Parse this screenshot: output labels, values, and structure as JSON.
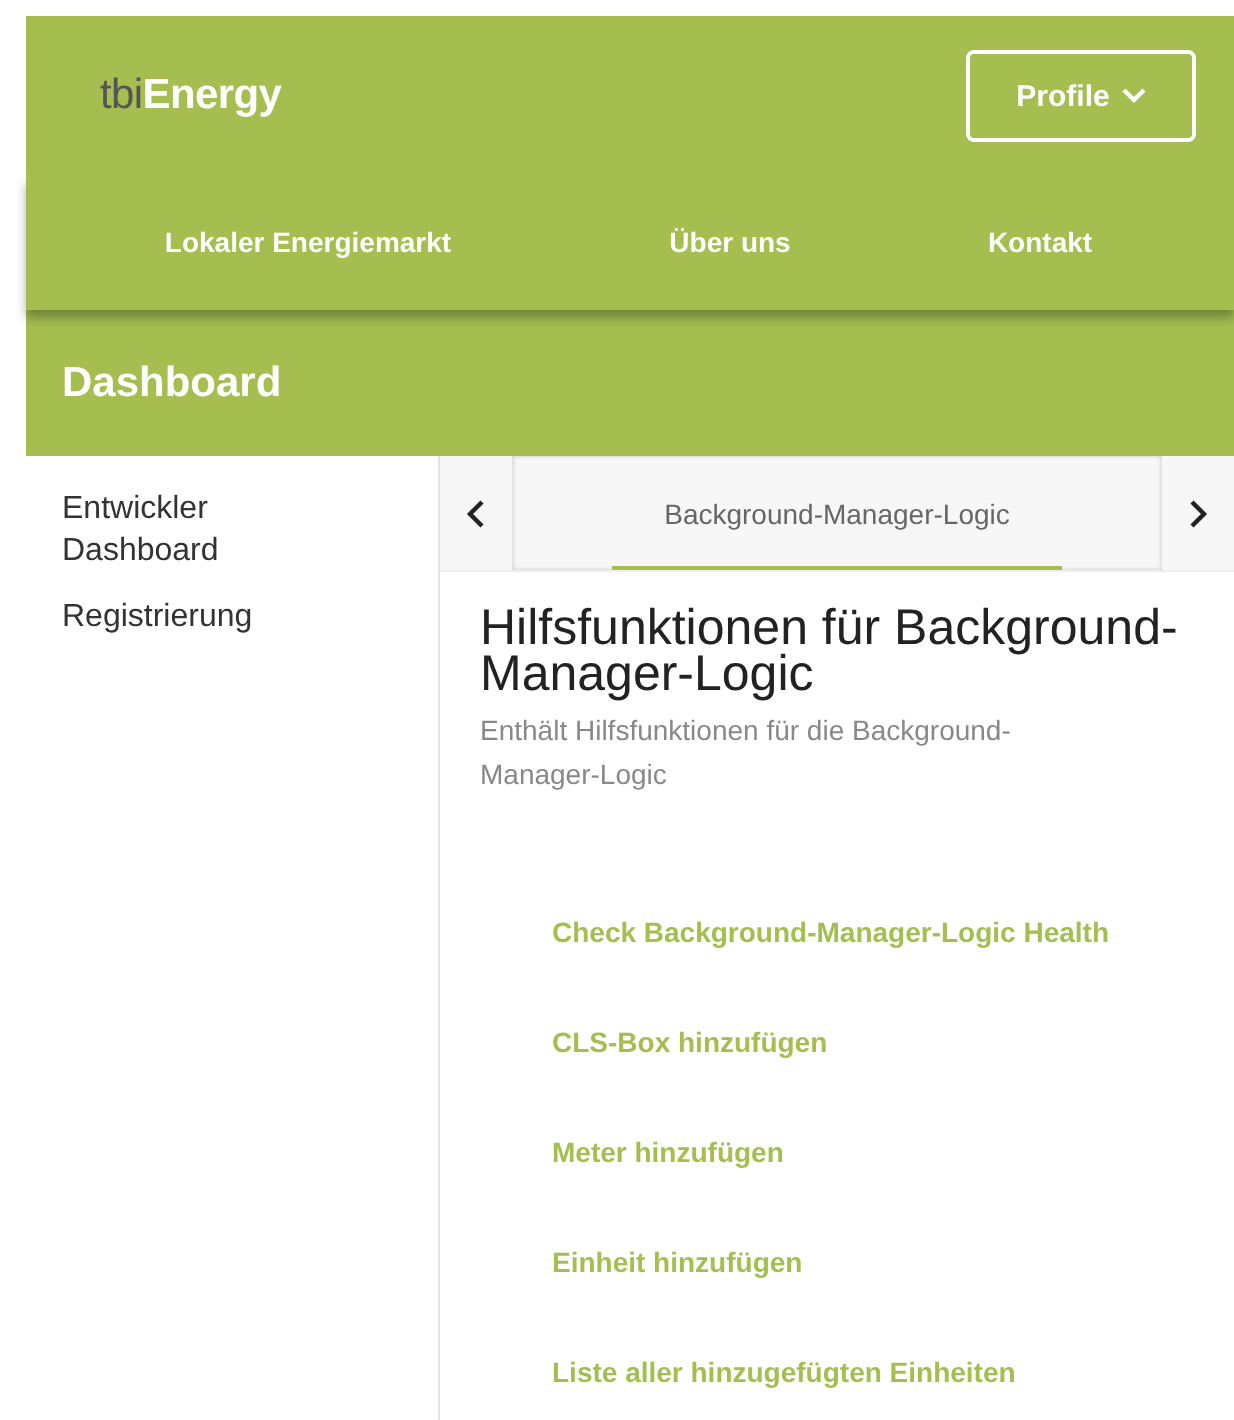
{
  "header": {
    "logo": {
      "prefix": "tbi",
      "name": "Energy"
    },
    "profile_button": {
      "label": "Profile"
    }
  },
  "nav": [
    {
      "label": "Lokaler Energiemarkt"
    },
    {
      "label": "Über uns"
    },
    {
      "label": "Kontakt"
    }
  ],
  "page_title": "Dashboard",
  "sidebar": {
    "items": [
      {
        "label": "Entwickler Dashboard"
      },
      {
        "label": "Registrierung"
      }
    ]
  },
  "tabs": [
    {
      "label": "Background-Manager-Logic",
      "selected": true
    }
  ],
  "content": {
    "title": "Hilfsfunktionen für Background-Manager-Logic",
    "description": "Enthält Hilfsfunktionen für die Background-Manager-Logic",
    "links": [
      {
        "label": "Check Background-Manager-Logic Health"
      },
      {
        "label": "CLS-Box hinzufügen"
      },
      {
        "label": "Meter hinzufügen"
      },
      {
        "label": "Einheit hinzufügen"
      },
      {
        "label": "Liste aller hinzugefügten Einheiten"
      }
    ]
  }
}
